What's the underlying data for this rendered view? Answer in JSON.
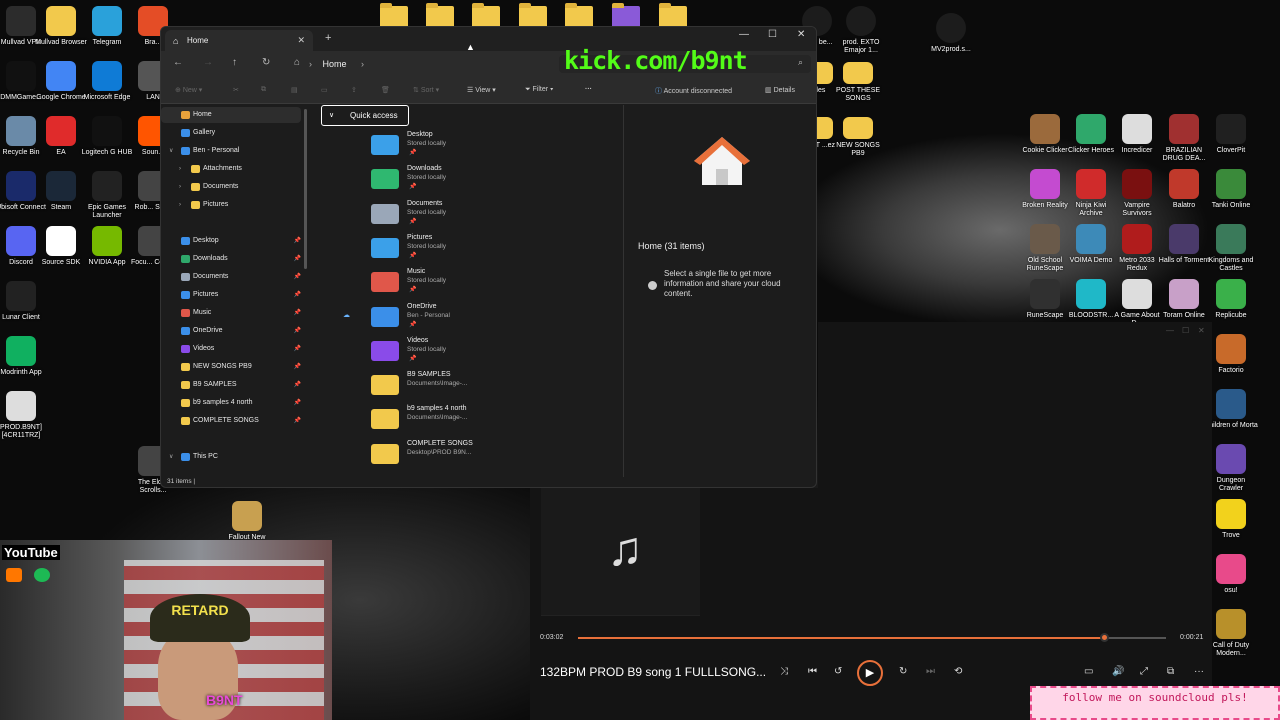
{
  "desktop": {
    "left_icons": [
      {
        "label": "Mullvad VPN",
        "icon": "mullvad-vpn-icon"
      },
      {
        "label": "Mullvad Browser",
        "icon": "mullvad-browser-icon"
      },
      {
        "label": "Telegram",
        "icon": "telegram-icon"
      },
      {
        "label": "Bra...",
        "icon": "brave-icon"
      },
      {
        "label": "DMMGame...",
        "icon": "dmm-icon"
      },
      {
        "label": "Google Chrome",
        "icon": "chrome-icon"
      },
      {
        "label": "Microsoft Edge",
        "icon": "edge-icon"
      },
      {
        "label": "LAN",
        "icon": "lan-icon"
      },
      {
        "label": "Recycle Bin",
        "icon": "recycle-bin-icon"
      },
      {
        "label": "EA",
        "icon": "ea-icon"
      },
      {
        "label": "Logitech G HUB",
        "icon": "logitech-icon"
      },
      {
        "label": "Soun...",
        "icon": "soundcloud-icon"
      },
      {
        "label": "Ubisoft Connect",
        "icon": "ubisoft-icon"
      },
      {
        "label": "Steam",
        "icon": "steam-icon"
      },
      {
        "label": "Epic Games Launcher",
        "icon": "epic-icon"
      },
      {
        "label": "Rob... Stu...",
        "icon": "roblox-icon"
      },
      {
        "label": "Discord",
        "icon": "discord-icon"
      },
      {
        "label": "Source SDK",
        "icon": "file-icon"
      },
      {
        "label": "NVIDIA App",
        "icon": "nvidia-icon"
      },
      {
        "label": "Focu... Cont...",
        "icon": "focus-icon"
      },
      {
        "label": "Lunar Client",
        "icon": "lunar-icon"
      },
      {
        "label": "Modrinth App",
        "icon": "modrinth-icon"
      },
      {
        "label": "PROD.B9NT] [4CR11TRZ]",
        "icon": "disc-icon"
      },
      {
        "label": "The Elder Scrolls...",
        "icon": "elder-scrolls-icon"
      },
      {
        "label": "Fallout New Vegas",
        "icon": "fallout-icon"
      }
    ],
    "top_icons": [
      {
        "label": "...ent be...",
        "icon": "media-file-icon"
      },
      {
        "label": "prod. EXTO Emajor 1...",
        "icon": "media-file-icon"
      },
      {
        "label": "MV2prod.s...",
        "icon": "video-file-icon"
      }
    ],
    "mid_folders": [
      {
        "label": "POST THESE SONGS"
      },
      {
        "label": "NEW SONGS PB9"
      },
      {
        "label": "...9NT ...ez"
      },
      {
        "label": "...les"
      }
    ],
    "right_icons": [
      {
        "label": "Cookie Clicker",
        "color": "#9b6a3c"
      },
      {
        "label": "Clicker Heroes",
        "color": "#2fa86b"
      },
      {
        "label": "Incredicer",
        "color": "#dddddd"
      },
      {
        "label": "BRAZILIAN DRUG DEA...",
        "color": "#a03030"
      },
      {
        "label": "CloverPit",
        "color": "#202020"
      },
      {
        "label": "Broken Reality",
        "color": "#c44bd0"
      },
      {
        "label": "Ninja Kiwi Archive",
        "color": "#d02b2b"
      },
      {
        "label": "Vampire Survivors",
        "color": "#7a1010"
      },
      {
        "label": "Balatro",
        "color": "#c0392b"
      },
      {
        "label": "Tanki Online",
        "color": "#3a8a3a"
      },
      {
        "label": "Old School RuneScape",
        "color": "#6a5a4a"
      },
      {
        "label": "VOIMA Demo",
        "color": "#3d8ab8"
      },
      {
        "label": "Metro 2033 Redux",
        "color": "#b01c1c"
      },
      {
        "label": "Halls of Torment",
        "color": "#4a3a6a"
      },
      {
        "label": "Kingdoms and Castles",
        "color": "#3a7a5a"
      },
      {
        "label": "RuneScape",
        "color": "#303030"
      },
      {
        "label": "BLOODSTR...",
        "color": "#1fb8c8"
      },
      {
        "label": "A Game About D...",
        "color": "#dddddd"
      },
      {
        "label": "Toram Online",
        "color": "#c8a0c8"
      },
      {
        "label": "Replicube",
        "color": "#3ab04a"
      },
      {
        "label": "Factorio",
        "color": "#c86a2a"
      },
      {
        "label": "Children of Morta",
        "color": "#2a5a8a"
      },
      {
        "label": "Dungeon Crawler",
        "color": "#6a4ab0"
      },
      {
        "label": "Trove",
        "color": "#f2d21c"
      },
      {
        "label": "osu!",
        "color": "#e84a8a"
      },
      {
        "label": "Call of Duty Modern...",
        "color": "#b8902a"
      }
    ]
  },
  "explorer": {
    "tab_label": "Home",
    "new_tab": "+",
    "breadcrumb": "Home",
    "toolbar": {
      "new": "New",
      "sort": "Sort",
      "view": "View",
      "filter": "Filter",
      "more": "···",
      "account": "Account disconnected",
      "details": "Details"
    },
    "sidebar": [
      {
        "label": "Home",
        "color": "#e9a23b",
        "pin": ""
      },
      {
        "label": "Gallery",
        "color": "#3b8fe9",
        "pin": ""
      },
      {
        "label": "Ben - Personal",
        "color": "#3b8fe9",
        "pin": ""
      },
      {
        "label": "Attachments",
        "color": "#f2c94c",
        "pin": ""
      },
      {
        "label": "Documents",
        "color": "#f2c94c",
        "pin": ""
      },
      {
        "label": "Pictures",
        "color": "#f2c94c",
        "pin": ""
      },
      {
        "label": "Desktop",
        "color": "#3b8fe9",
        "pin": "📌"
      },
      {
        "label": "Downloads",
        "color": "#2fa86b",
        "pin": "📌"
      },
      {
        "label": "Documents",
        "color": "#9aa7b8",
        "pin": "📌"
      },
      {
        "label": "Pictures",
        "color": "#3b8fe9",
        "pin": "📌"
      },
      {
        "label": "Music",
        "color": "#e0574a",
        "pin": "📌"
      },
      {
        "label": "OneDrive",
        "color": "#3b8fe9",
        "pin": "📌"
      },
      {
        "label": "Videos",
        "color": "#8a4be9",
        "pin": "📌"
      },
      {
        "label": "NEW SONGS PB9",
        "color": "#f2c94c",
        "pin": "📌"
      },
      {
        "label": "B9 SAMPLES",
        "color": "#f2c94c",
        "pin": "📌"
      },
      {
        "label": "b9 samples 4 north",
        "color": "#f2c94c",
        "pin": "📌"
      },
      {
        "label": "COMPLETE SONGS",
        "color": "#f2c94c",
        "pin": "📌"
      },
      {
        "label": "This PC",
        "color": "#3b8fe9",
        "pin": ""
      }
    ],
    "quick_access_label": "Quick access",
    "items": [
      {
        "name": "Desktop",
        "sub": "Stored locally",
        "color": "#3ba0e9"
      },
      {
        "name": "Downloads",
        "sub": "Stored locally",
        "color": "#2fb870"
      },
      {
        "name": "Documents",
        "sub": "Stored locally",
        "color": "#9aa7b8"
      },
      {
        "name": "Pictures",
        "sub": "Stored locally",
        "color": "#3ba0e9"
      },
      {
        "name": "Music",
        "sub": "Stored locally",
        "color": "#e0574a"
      },
      {
        "name": "OneDrive",
        "sub": "Ben - Personal",
        "color": "#3b8fe9"
      },
      {
        "name": "Videos",
        "sub": "Stored locally",
        "color": "#8a4be9"
      },
      {
        "name": "B9 SAMPLES",
        "sub": "Documents\\Image-...",
        "color": "#f2c94c"
      },
      {
        "name": "b9 samples 4 north",
        "sub": "Documents\\Image-...",
        "color": "#f2c94c"
      },
      {
        "name": "COMPLETE SONGS",
        "sub": "Desktop\\PROD B9N...",
        "color": "#f2c94c"
      }
    ],
    "details_title": "Home (31 items)",
    "details_message": "Select a single file to get more information and share your cloud content.",
    "status": "31 items"
  },
  "overlay": {
    "kick": "kick.com/b9nt",
    "youtube": "YouTube",
    "hat_text": "RETARD",
    "brand": "B9NT",
    "follow": "follow me on soundcloud pls!"
  },
  "player": {
    "elapsed": "0:03:02",
    "remaining": "0:00:21",
    "progress_percent": 89.5,
    "title": "132BPM PROD B9 song 1 FULLLSONG..."
  }
}
